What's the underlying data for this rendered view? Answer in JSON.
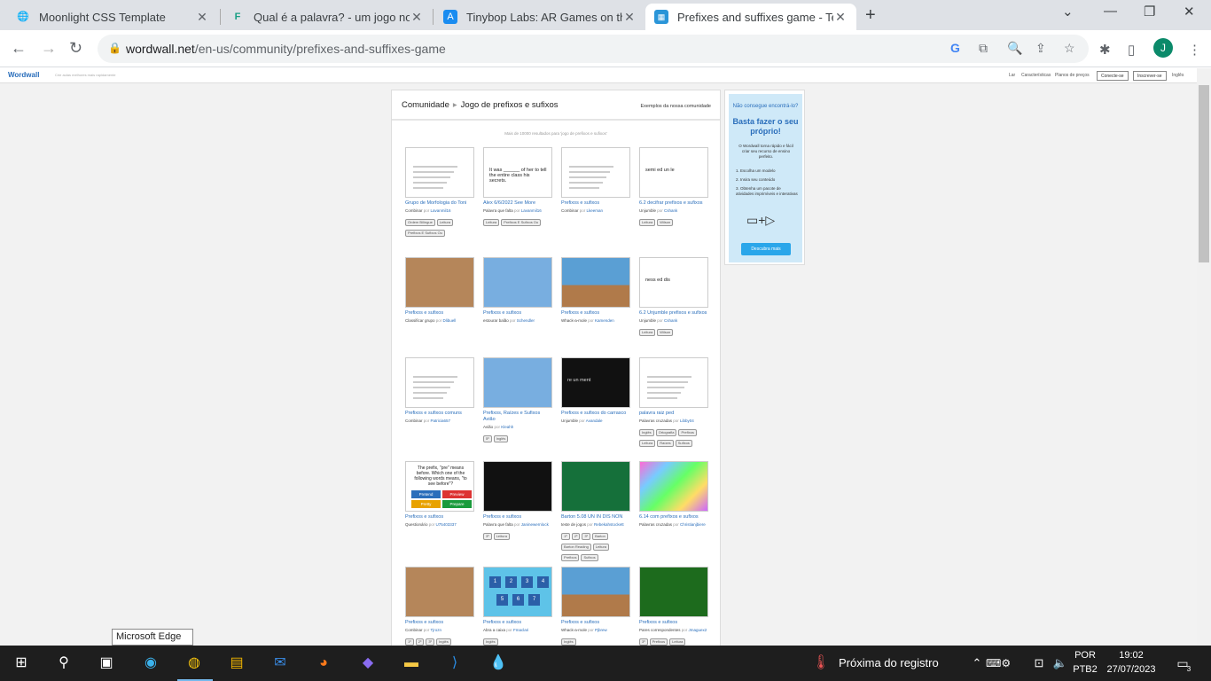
{
  "browser": {
    "tabs": [
      {
        "title": "Moonlight CSS Template",
        "active": false
      },
      {
        "title": "Qual é a palavra? - um jogo no Fi",
        "active": false
      },
      {
        "title": "Tinybop Labs: AR Games on the A",
        "active": false
      },
      {
        "title": "Prefixes and suffixes game - Teac",
        "active": true
      }
    ],
    "url_host": "wordwall.net",
    "url_path": "/en-us/community/prefixes-and-suffixes-game",
    "profile_initial": "J"
  },
  "site": {
    "logo": "Wordwall",
    "tagline": "Crie aulas melhores mais rapidamente",
    "nav": [
      "Lar",
      "Características",
      "Planos de preços"
    ],
    "login": "Conecte-se",
    "signup": "Inscrever-se",
    "language": "Inglês"
  },
  "main": {
    "crumb_home": "Comunidade",
    "crumb_current": "Jogo de prefixos e sufixos",
    "examples": "Exemplos da nossa comunidade",
    "results": "Mais de 10000 resultados para 'jogo de prefixos e sufixos'"
  },
  "cards": [
    {
      "title": "Grupo de Morfologia do Toni",
      "type": "Combinar",
      "author": "Lavanmil16",
      "tags": [
        "Ordem Bilíngue",
        "Leitura",
        "Prefixos E Sufixos Ou"
      ]
    },
    {
      "title": "Alex 6/6/2022 See More",
      "type": "Palavra que falta",
      "author": "Lavanmil16",
      "tags": [
        "Leitura",
        "Prefixos E Sufixos Ou"
      ],
      "thumb_text": "It was ______ of her to tell the entire class his secrets."
    },
    {
      "title": "Prefixos e sufixos",
      "type": "Combinar",
      "author": "Lkeeman",
      "tags": []
    },
    {
      "title": "6.2 decifrar prefixos e sufixos",
      "type": "Unjumble",
      "author": "Cshank",
      "tags": [
        "Leitura",
        "Wilson"
      ],
      "thumb_text": "semi ed un le"
    },
    {
      "title": "Prefixos e sufixos",
      "type": "Classificar grupo",
      "author": "Dlibuell",
      "tags": []
    },
    {
      "title": "Prefixos e sufixos",
      "type": "estourar balão",
      "author": "Schendler",
      "tags": []
    },
    {
      "title": "Prefixos e sufixos",
      "type": "Whack-a-mole",
      "author": "Kamenden",
      "tags": []
    },
    {
      "title": "6.2 Unjumble prefixos e sufixos",
      "type": "Unjumble",
      "author": "Cshank",
      "tags": [
        "Leitura",
        "Wilson"
      ],
      "thumb_text": "ness ed dis"
    },
    {
      "title": "Prefixos e sufixos comuns",
      "type": "Combinar",
      "author": "Patricia657",
      "tags": []
    },
    {
      "title": "Prefixos, Raízes e Sufixos Avião",
      "type": "Avião",
      "author": "Kleahh",
      "tags": [
        "5º",
        "Inglês"
      ]
    },
    {
      "title": "Prefixos e sufixos do carrasco",
      "type": "Unjumble",
      "author": "Avandale",
      "tags": [],
      "thumb_text": "re un ment"
    },
    {
      "title": "palavra raiz ped",
      "type": "Palavras cruzadas",
      "author": "Libby04",
      "tags": [
        "Inglês",
        "Ortografia",
        "Prefixos",
        "Leitura",
        "Raízes",
        "Sufixos"
      ]
    },
    {
      "title": "Prefixos e sufixos",
      "type": "Questionário",
      "author": "U75403337",
      "tags": [],
      "thumb_text": "The prefix, \"pre\" means before. Which one of the following words means, \"to see before\"?",
      "options": [
        "Pretend",
        "Preview",
        "Pretty",
        "Prepare"
      ]
    },
    {
      "title": "Prefixos e sufixos",
      "type": "Palavra que falta",
      "author": "Janinewernlock",
      "tags": [
        "3º",
        "Leitura"
      ]
    },
    {
      "title": "Barton 5.08 UN IN DIS NON",
      "type": "teste de jogos",
      "author": "Rebekahstockett",
      "tags": [
        "1º",
        "2º",
        "3º",
        "Barton",
        "Barton Reading",
        "Leitura",
        "Prefixos",
        "Sufixos"
      ]
    },
    {
      "title": "6.14 com prefixos e sufixos",
      "type": "Palavras cruzadas",
      "author": "Christianjbiere",
      "tags": []
    },
    {
      "title": "Prefixos e sufixos",
      "type": "Combinar",
      "author": "Tjrozn",
      "tags": [
        "1º",
        "2º",
        "3º",
        "Inglês"
      ]
    },
    {
      "title": "Prefixos e sufixos",
      "type": "Abra a caixa",
      "author": "Fmaclari",
      "tags": [
        "Inglês"
      ],
      "thumb_text": [
        "1",
        "2",
        "3",
        "4",
        "5",
        "6",
        "7"
      ]
    },
    {
      "title": "Prefixos e sufixos",
      "type": "Whack-a-mole",
      "author": "Pjbrew",
      "tags": [
        "Inglês"
      ]
    },
    {
      "title": "Prefixos e sufixos",
      "type": "Pares correspondentes",
      "author": "Jmaguex2",
      "tags": [
        "3º",
        "Prefixos",
        "Leitura"
      ]
    }
  ],
  "by_label": "por",
  "side": {
    "line1": "Não consegue encontrá-lo?",
    "line2": "Basta fazer o seu próprio!",
    "desc": "O Wordwall torna rápido e fácil criar seu recurso de ensino perfeito.",
    "steps": [
      "1. Escolha um modelo",
      "2. Insira seu conteúdo",
      "3. Obtenha um pacote de atividades imprimíveis e interativas"
    ],
    "button": "Descubra mais"
  },
  "tooltip": "Microsoft Edge",
  "taskbar": {
    "weather": "Próxima do registro",
    "lang1": "POR",
    "lang2": "PTB2",
    "time": "19:02",
    "date": "27/07/2023",
    "notif": "3"
  }
}
